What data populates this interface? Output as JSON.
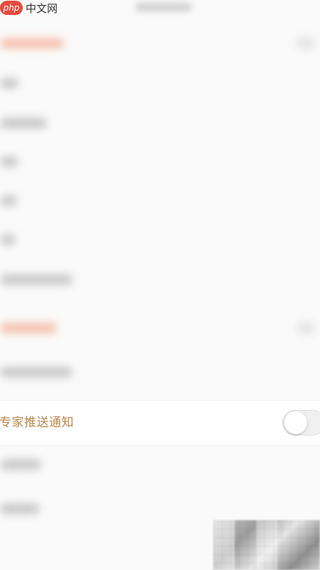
{
  "watermark": {
    "logo_badge": "php",
    "logo_text": "中文网"
  },
  "notification_row": {
    "label": "专家推送通知",
    "toggle_on": false
  },
  "colors": {
    "label": "#b9874e",
    "background": "#fafafa",
    "toggle_track": "#f0f0f0"
  }
}
